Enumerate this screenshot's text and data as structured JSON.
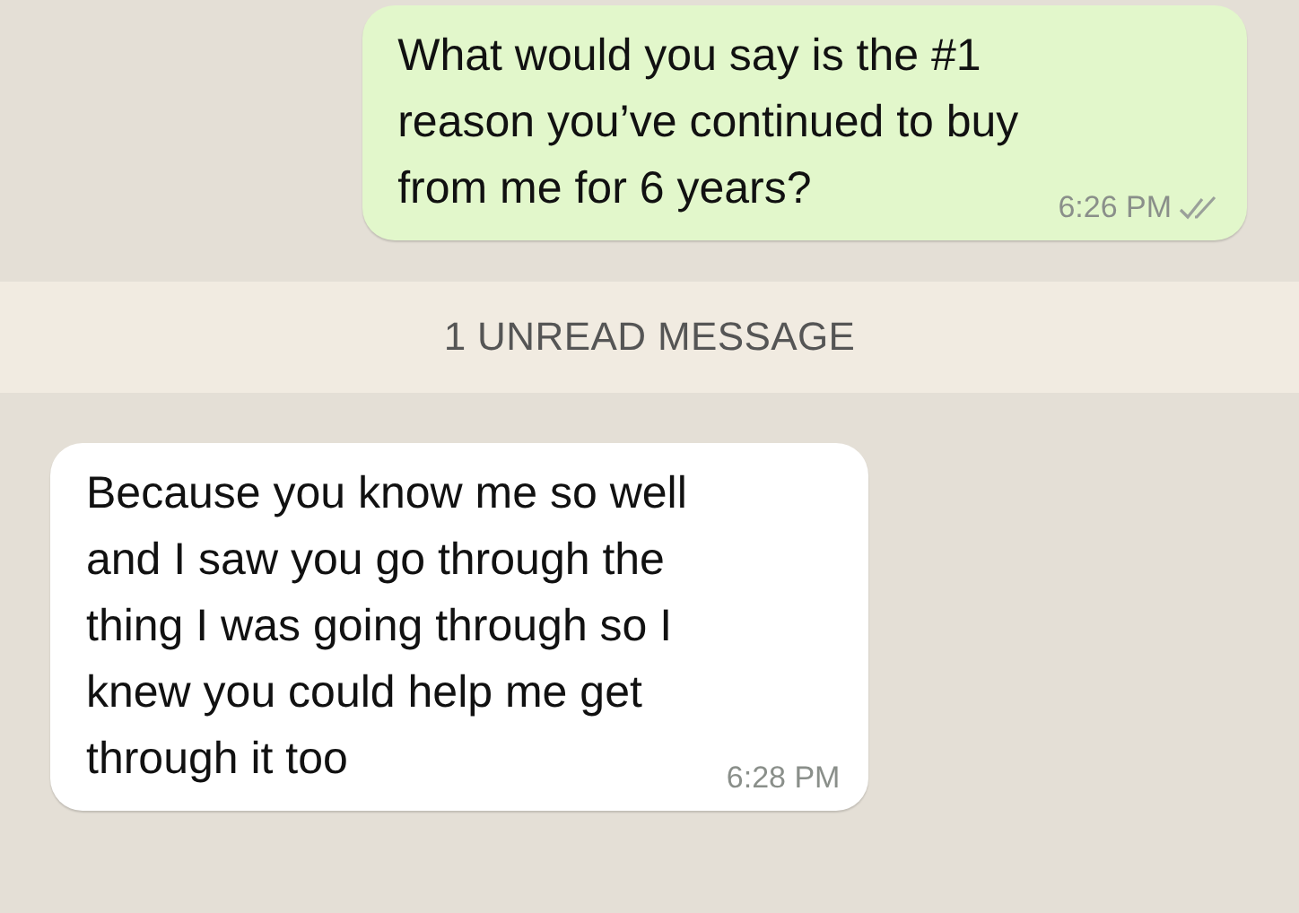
{
  "messages": [
    {
      "kind": "outgoing",
      "text": "What would you say is the #1\nreason you’ve continued to buy\nfrom me for 6 years?",
      "time": "6:26 PM"
    },
    {
      "kind": "unread_banner",
      "text": "1 UNREAD MESSAGE"
    },
    {
      "kind": "incoming",
      "text": "Because you know me so well\nand I saw you go through the\nthing I was going through so I\nknew you could help me get\nthrough it too",
      "time": "6:28 PM"
    }
  ]
}
